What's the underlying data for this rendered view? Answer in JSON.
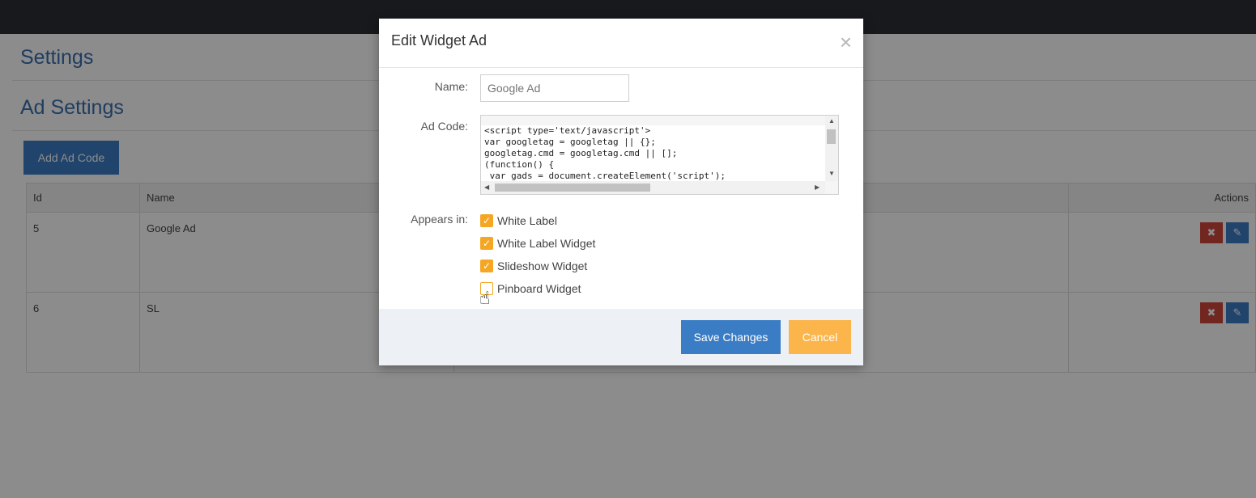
{
  "page": {
    "section_title": "Settings",
    "subsection_title": "Ad Settings",
    "add_button_label": "Add Ad Code",
    "table": {
      "columns": [
        "Id",
        "Name",
        "Actions"
      ],
      "rows": [
        {
          "id": "5",
          "name": "Google Ad"
        },
        {
          "id": "6",
          "name": "SL"
        }
      ],
      "delete_glyph": "✖",
      "edit_glyph": "✎"
    }
  },
  "modal": {
    "title": "Edit Widget Ad",
    "close_glyph": "×",
    "name_label": "Name:",
    "name_placeholder": "Google Ad",
    "ad_code_label": "Ad Code:",
    "ad_code_lines": [
      "<script type='text/javascript'>",
      "var googletag = googletag || {};",
      "googletag.cmd = googletag.cmd || [];",
      "(function() {",
      " var gads = document.createElement('script');"
    ],
    "appears_in_label": "Appears in:",
    "options": [
      {
        "label": "White Label",
        "checked": true
      },
      {
        "label": "White Label Widget",
        "checked": true
      },
      {
        "label": "Slideshow Widget",
        "checked": true
      },
      {
        "label": "Pinboard Widget",
        "checked": false
      }
    ],
    "save_label": "Save Changes",
    "cancel_label": "Cancel"
  },
  "colors": {
    "primary": "#3b7dc4",
    "warning": "#fbb54b",
    "checkbox": "#f5a623",
    "danger": "#d0463b",
    "topbar": "#2b2f33"
  },
  "icons": {
    "close": "close-icon",
    "delete": "delete-icon",
    "edit": "pencil-icon",
    "check": "checkmark-icon",
    "cursor": "hand-cursor-icon"
  }
}
